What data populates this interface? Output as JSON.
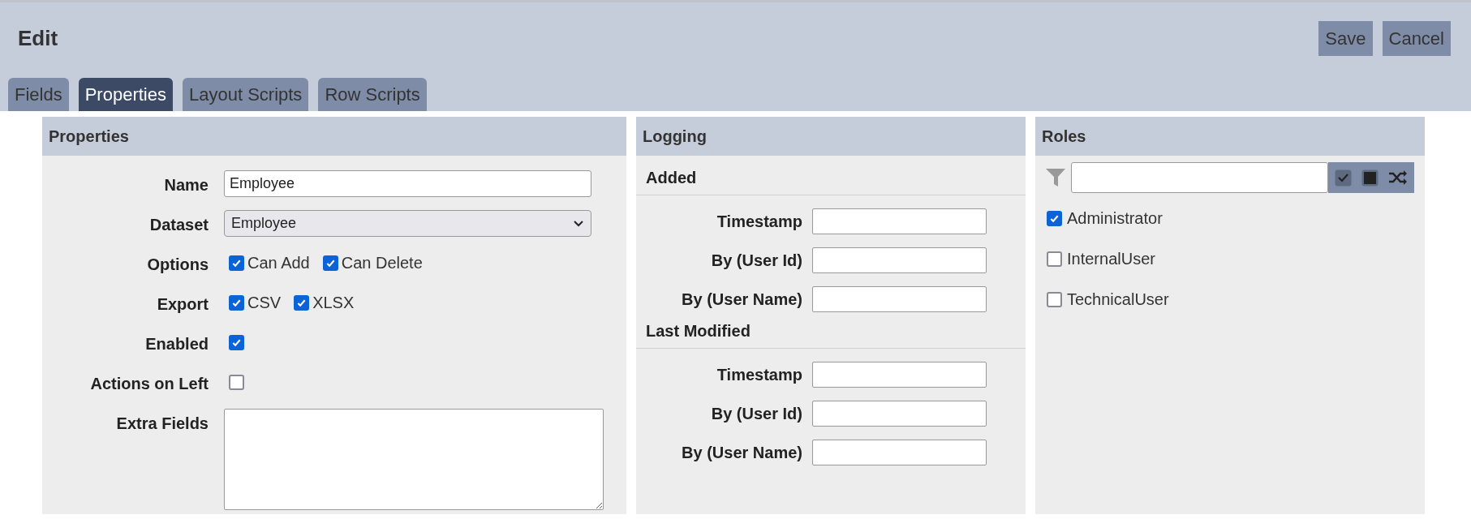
{
  "header": {
    "title": "Edit",
    "buttons": [
      "Save",
      "Cancel"
    ]
  },
  "tabs": [
    {
      "label": "Fields",
      "selected": false
    },
    {
      "label": "Properties",
      "selected": true
    },
    {
      "label": "Layout Scripts",
      "selected": false
    },
    {
      "label": "Row Scripts",
      "selected": false
    }
  ],
  "properties": {
    "title": "Properties",
    "rows": [
      {
        "kind": "text",
        "label": "Name",
        "value": "Employee"
      },
      {
        "kind": "select",
        "label": "Dataset",
        "value": "Employee"
      },
      {
        "kind": "checks",
        "label": "Options",
        "options": [
          {
            "label": "Can Add",
            "checked": true
          },
          {
            "label": "Can Delete",
            "checked": true
          }
        ]
      },
      {
        "kind": "checks",
        "label": "Export",
        "options": [
          {
            "label": "CSV",
            "checked": true
          },
          {
            "label": "XLSX",
            "checked": true
          }
        ]
      },
      {
        "kind": "check",
        "label": "Enabled",
        "checked": true
      },
      {
        "kind": "check",
        "label": "Actions on Left",
        "checked": false
      },
      {
        "kind": "textarea",
        "label": "Extra Fields"
      }
    ]
  },
  "logging": {
    "title": "Logging",
    "groups": [
      {
        "title": "Added",
        "fields": [
          "Timestamp",
          "By (User Id)",
          "By (User Name)"
        ]
      },
      {
        "title": "Last Modified",
        "fields": [
          "Timestamp",
          "By (User Id)",
          "By (User Name)"
        ]
      }
    ]
  },
  "roles": {
    "title": "Roles",
    "items": [
      {
        "label": "Administrator",
        "checked": true
      },
      {
        "label": "InternalUser",
        "checked": false
      },
      {
        "label": "TechnicalUser",
        "checked": false
      }
    ]
  }
}
